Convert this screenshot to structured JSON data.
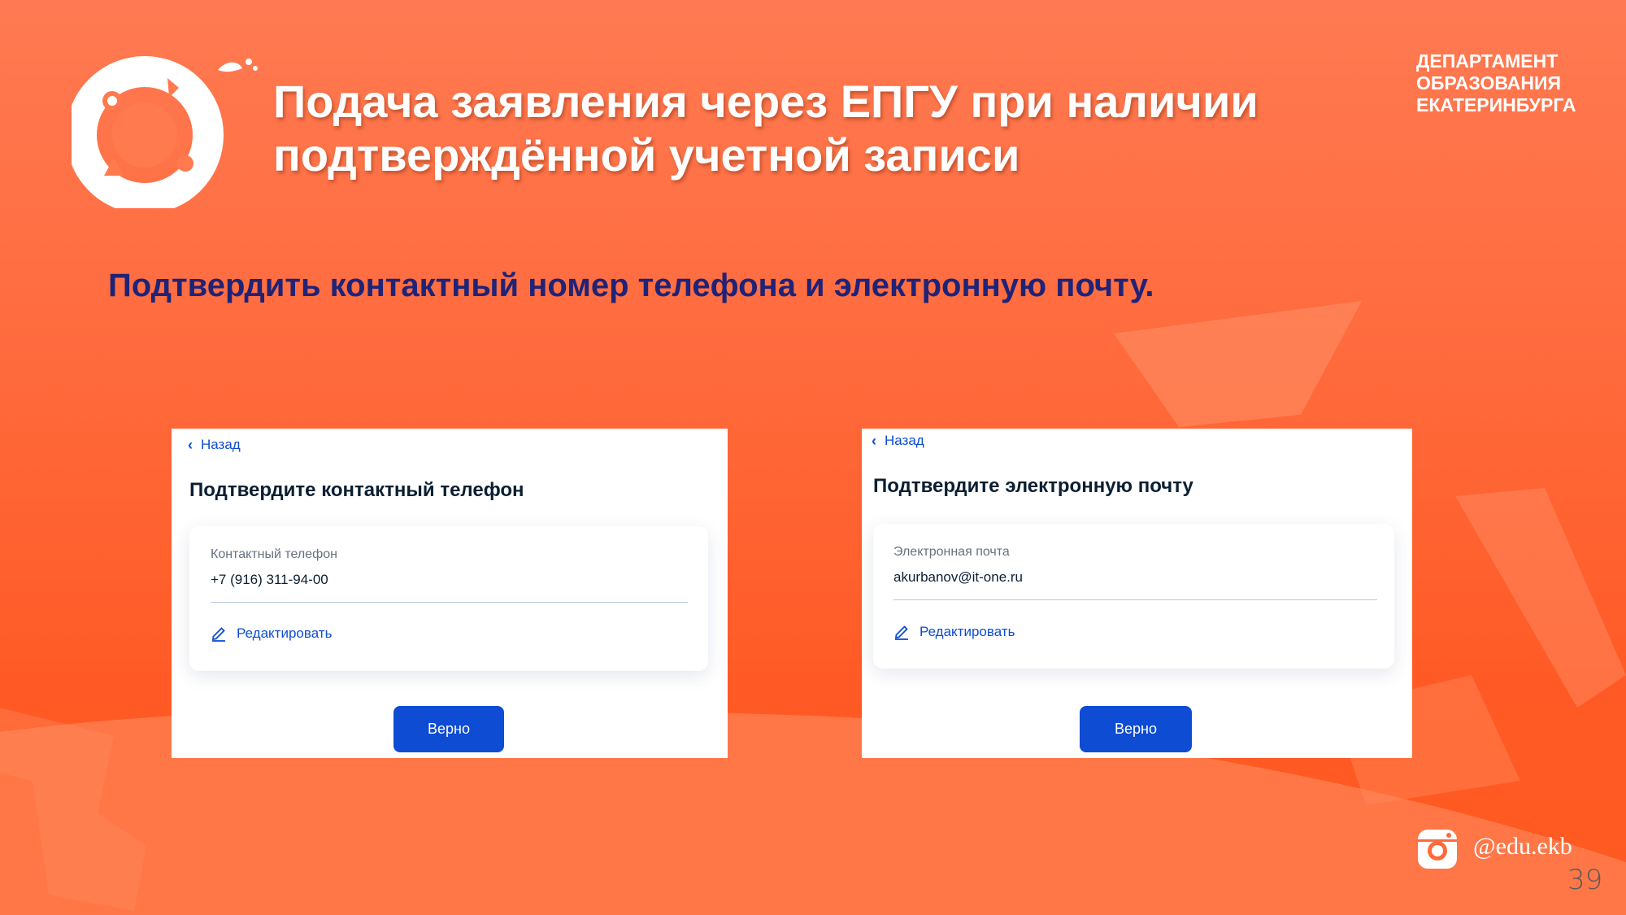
{
  "slide": {
    "title_line1": "Подача заявления через ЕПГУ при наличии",
    "title_line2": "подтверждённой учетной записи",
    "department": [
      "ДЕПАРТАМЕНТ",
      "ОБРАЗОВАНИЯ",
      "ЕКАТЕРИНБУРГА"
    ],
    "subtitle": "Подтвердить контактный номер телефона и электронную почту.",
    "page_number": "39",
    "instagram_handle": "@edu.ekb",
    "colors": {
      "background": "#ff6a3c",
      "title_text": "#ffffff",
      "subtitle_text": "#1f2377",
      "accent_blue": "#0d4cd3"
    }
  },
  "phone_screen": {
    "back_label": "Назад",
    "heading": "Подтвердите контактный телефон",
    "field_label": "Контактный телефон",
    "field_value": "+7 (916) 311-94-00",
    "edit_label": "Редактировать",
    "confirm_label": "Верно"
  },
  "email_screen": {
    "back_label": "Назад",
    "heading": "Подтвердите электронную почту",
    "field_label": "Электронная почта",
    "field_value": "akurbanov@it-one.ru",
    "edit_label": "Редактировать",
    "confirm_label": "Верно"
  },
  "icons": [
    "logo-ring-icon",
    "chevron-left-icon",
    "pencil-icon",
    "instagram-icon"
  ]
}
